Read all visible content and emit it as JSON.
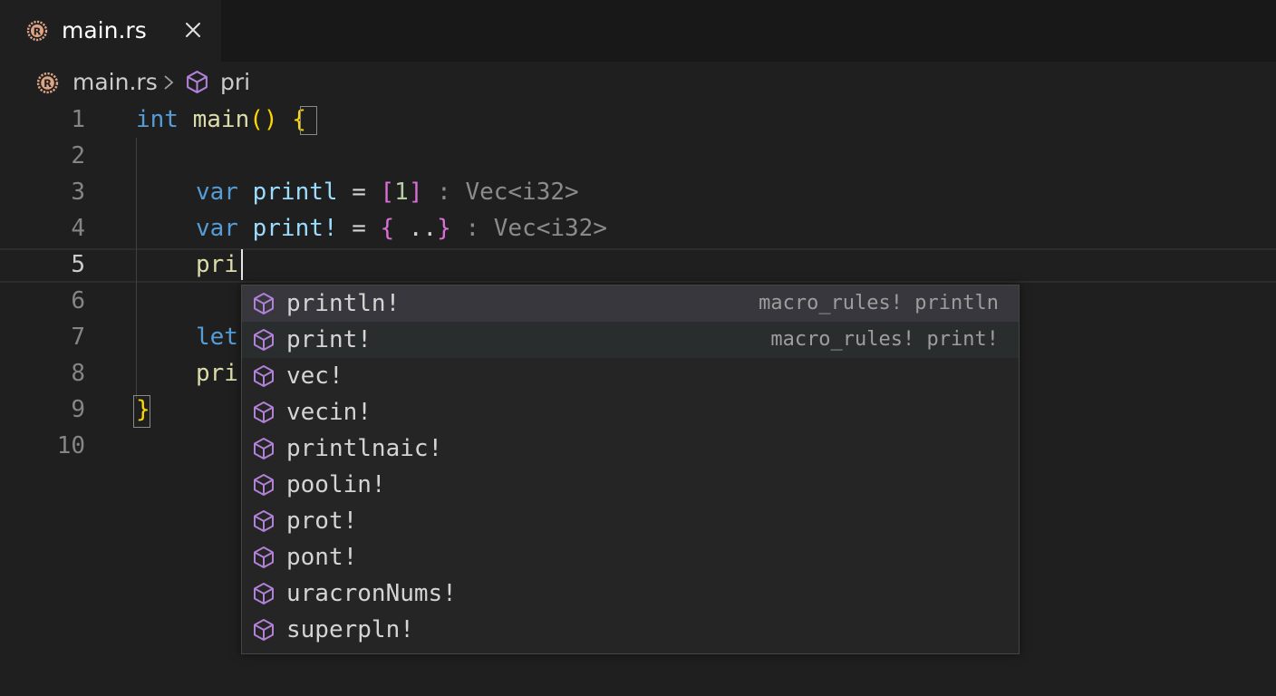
{
  "tab": {
    "label": "main.rs",
    "file_icon": "rust-file-icon",
    "close_icon": "close-icon"
  },
  "breadcrumb": {
    "file": "main.rs",
    "separator_icon": "chevron-right-icon",
    "symbol_icon": "cube-icon",
    "symbol": "pri"
  },
  "editor": {
    "line_numbers": [
      "1",
      "2",
      "3",
      "4",
      "5",
      "6",
      "7",
      "8",
      "9",
      "10"
    ],
    "active_line": "5",
    "lines": {
      "l1": {
        "kw": "int",
        "fn": "main",
        "paren": "()",
        "brace": "{"
      },
      "l3": {
        "kw": "var",
        "name": "printl",
        "eq": "=",
        "open": "[",
        "val": "1",
        "close": "]",
        "hint": ": Vec<i32>"
      },
      "l4": {
        "kw": "var",
        "name": "print!",
        "eq": "=",
        "open": "{",
        "dots": "..",
        "close": "}",
        "hint": ": Vec<i32>"
      },
      "l5": {
        "text": "pri"
      },
      "l7": {
        "text": "let"
      },
      "l8": {
        "text": "pri"
      },
      "l9": {
        "brace": "}"
      }
    }
  },
  "suggestions": {
    "icon": "cube-icon",
    "icon_color": "#b180d7",
    "items": [
      {
        "label": "println!",
        "detail": "macro_rules! println"
      },
      {
        "label": "print!",
        "detail": "macro_rules! print!"
      },
      {
        "label": "vec!",
        "detail": ""
      },
      {
        "label": "vecin!",
        "detail": ""
      },
      {
        "label": "printlnaic!",
        "detail": ""
      },
      {
        "label": "poolin!",
        "detail": ""
      },
      {
        "label": "prot!",
        "detail": ""
      },
      {
        "label": "pont!",
        "detail": ""
      },
      {
        "label": "uracronNums!",
        "detail": ""
      },
      {
        "label": "superpln!",
        "detail": ""
      }
    ]
  },
  "colors": {
    "background": "#1f1f1f",
    "keyword": "#569cd6",
    "function": "#dcdcaa",
    "variable": "#9cdcfe",
    "bracket_gold": "#ffd700",
    "bracket_purple": "#da70d6",
    "rust_orange": "#dea584"
  }
}
